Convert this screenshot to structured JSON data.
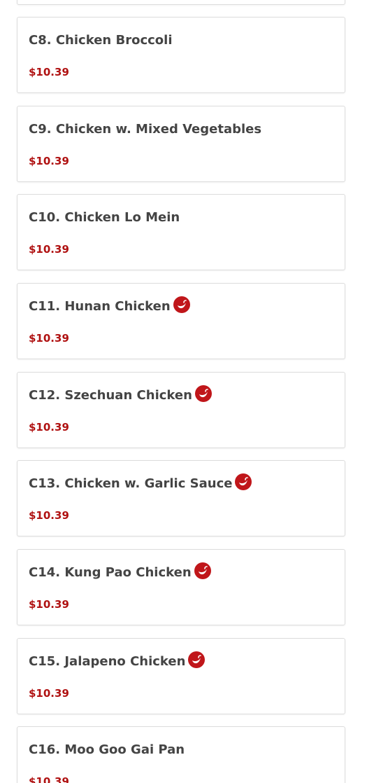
{
  "menu": {
    "accent_color": "#b01212",
    "spicy_icon": "chili-pepper-icon",
    "items": [
      {
        "name": "",
        "price": "",
        "spicy": false
      },
      {
        "name": "C8. Chicken Broccoli",
        "price": "$10.39",
        "spicy": false
      },
      {
        "name": "C9. Chicken w. Mixed Vegetables",
        "price": "$10.39",
        "spicy": false
      },
      {
        "name": "C10. Chicken Lo Mein",
        "price": "$10.39",
        "spicy": false
      },
      {
        "name": "C11. Hunan Chicken",
        "price": "$10.39",
        "spicy": true
      },
      {
        "name": "C12. Szechuan Chicken",
        "price": "$10.39",
        "spicy": true
      },
      {
        "name": "C13. Chicken w. Garlic Sauce",
        "price": "$10.39",
        "spicy": true
      },
      {
        "name": "C14. Kung Pao Chicken",
        "price": "$10.39",
        "spicy": true
      },
      {
        "name": "C15. Jalapeno Chicken",
        "price": "$10.39",
        "spicy": true
      },
      {
        "name": "C16. Moo Goo Gai Pan",
        "price": "$10.39",
        "spicy": false
      }
    ]
  }
}
